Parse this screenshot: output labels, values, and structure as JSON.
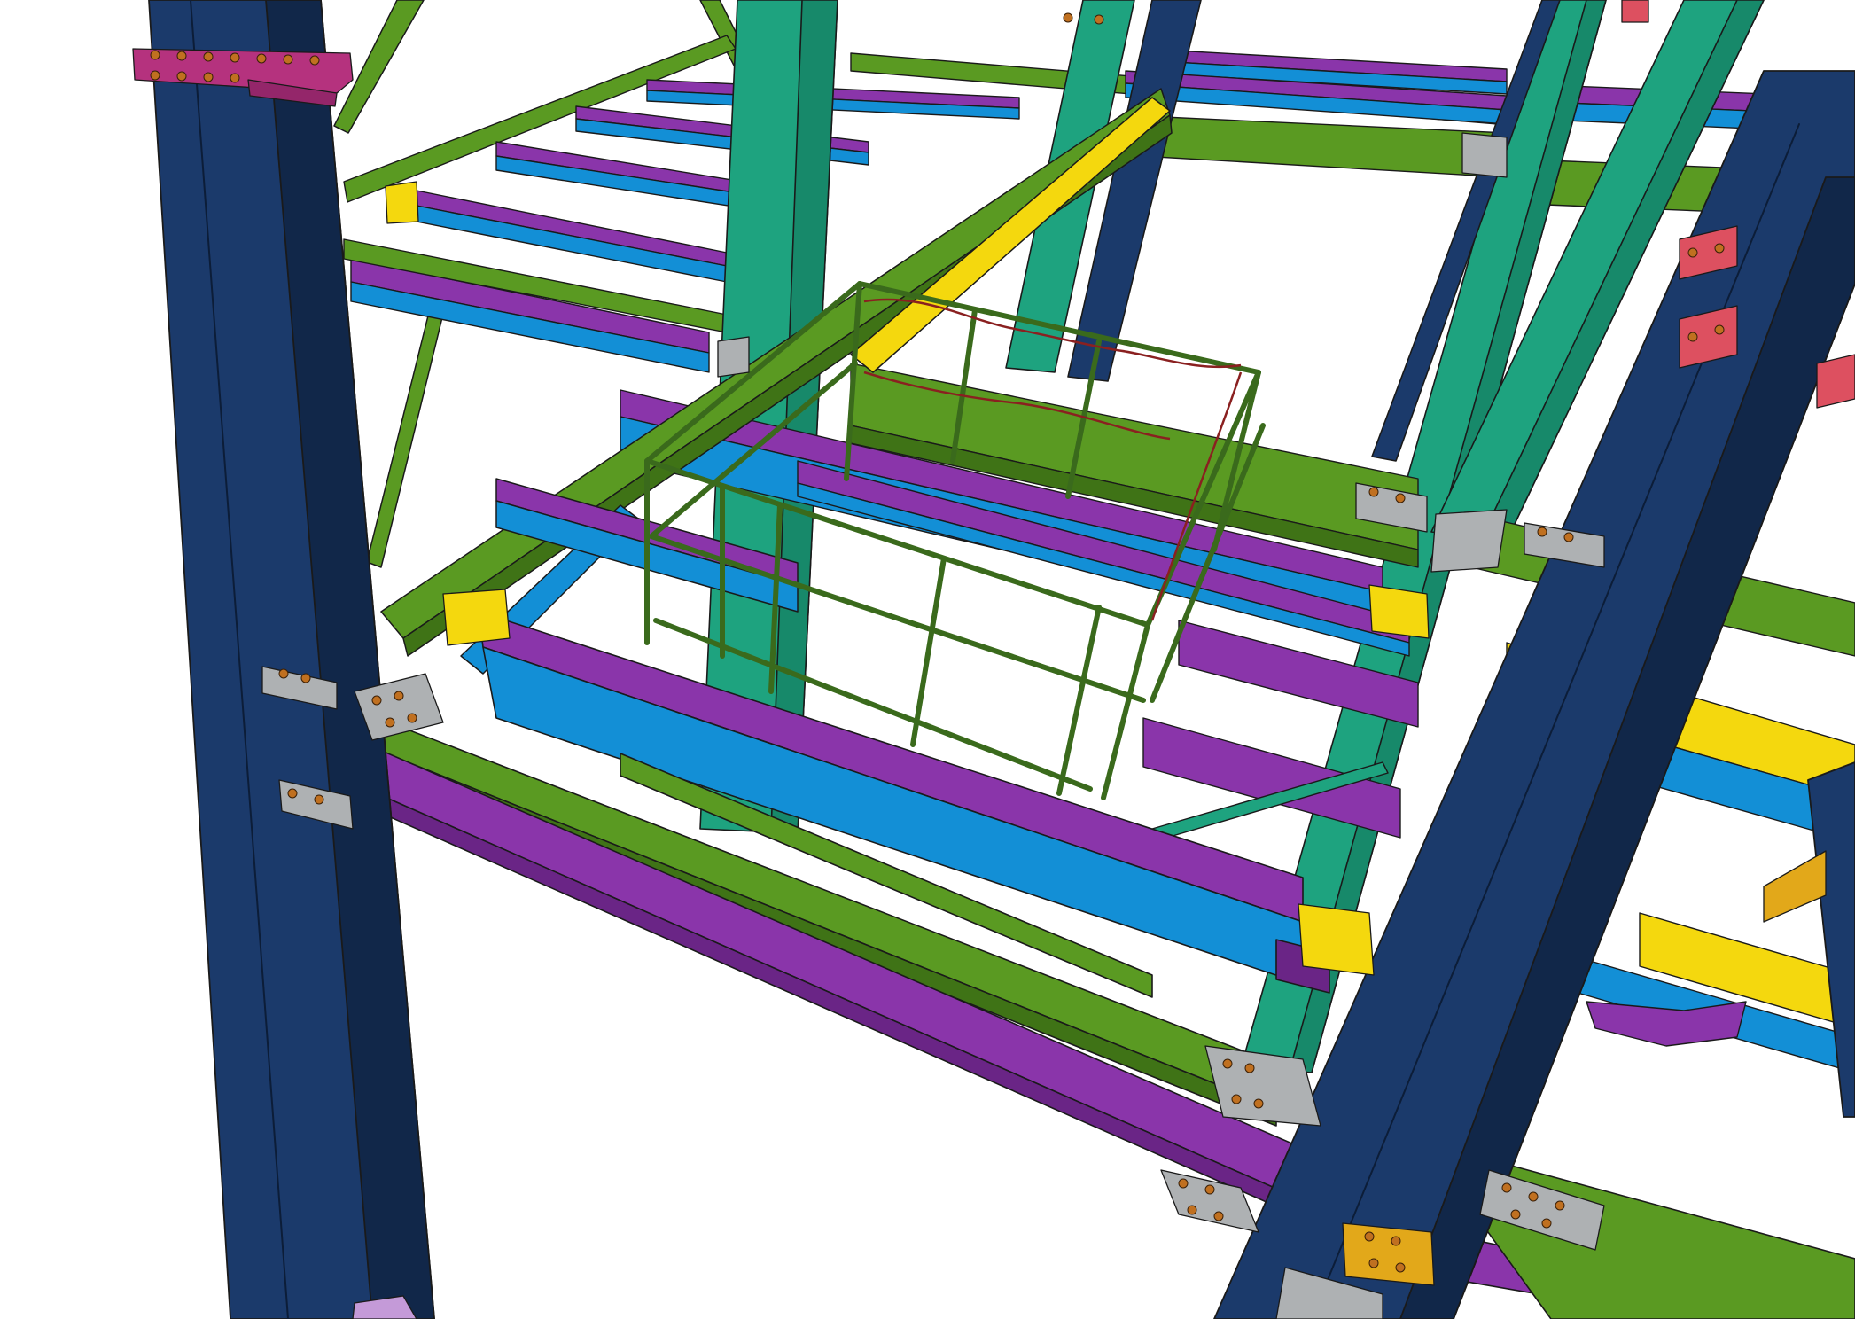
{
  "scene": {
    "kind": "3d-steel-structure-model",
    "background": "#ffffff"
  },
  "palette": {
    "column_navy": "#1b3a6b",
    "column_navy_dark": "#112749",
    "column_teal": "#1ea37f",
    "beam_green": "#5a9a22",
    "beam_green_dark": "#3f7316",
    "beam_purple": "#8a35aa",
    "beam_purple_dark": "#6a2586",
    "beam_blue": "#138fd6",
    "beam_yellow": "#f4d80e",
    "plate_grey": "#aeb1b3",
    "plate_magenta": "#b5327e",
    "plate_red": "#dd5060",
    "bolt_orange": "#c07020",
    "railing_green": "#3a6a1c",
    "cable_red": "#8a2020",
    "edge_dark": "#1a1a1a"
  },
  "icons": {
    "connection": "bolted-plate-icon"
  }
}
